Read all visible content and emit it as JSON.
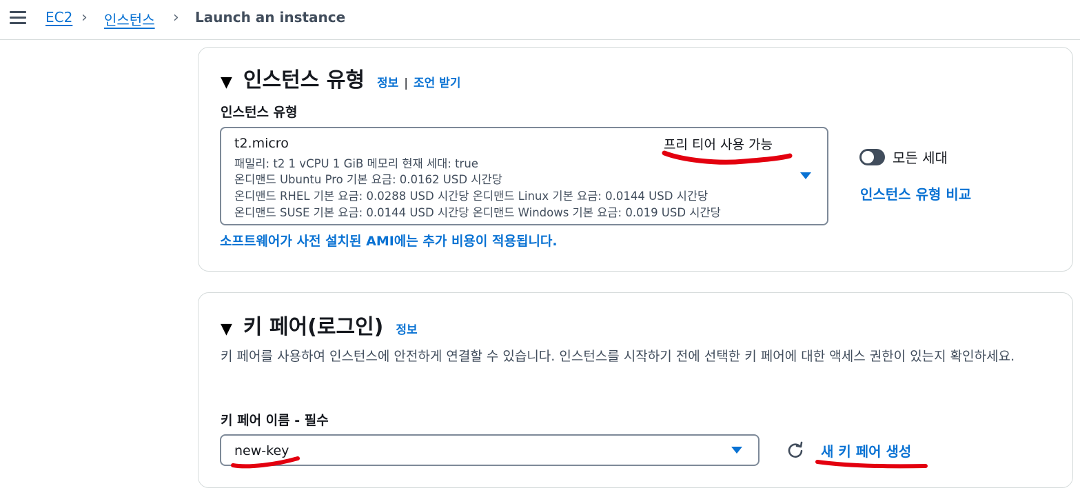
{
  "breadcrumb": {
    "items": [
      "EC2",
      "인스턴스"
    ],
    "current": "Launch an instance"
  },
  "instance_type_section": {
    "title": "인스턴스 유형",
    "info_link": "정보",
    "separator": "|",
    "advice_link": "조언 받기",
    "field_label": "인스턴스 유형",
    "selected": {
      "name": "t2.micro",
      "badge": "프리 티어 사용 가능",
      "line1": "패밀리: t2     1 vCPU     1 GiB 메모리     현재 세대: true",
      "line2": "온디맨드 Ubuntu Pro 기본 요금: 0.0162 USD 시간당",
      "line3": "온디맨드 RHEL 기본 요금: 0.0288 USD 시간당     온디맨드 Linux 기본 요금: 0.0144 USD 시간당",
      "line4": "온디맨드 SUSE 기본 요금: 0.0144 USD 시간당     온디맨드 Windows 기본 요금: 0.019 USD 시간당"
    },
    "toggle_label": "모든 세대",
    "toggle_on": false,
    "compare_link": "인스턴스 유형 비교",
    "ami_note": "소프트웨어가 사전 설치된 AMI에는 추가 비용이 적용됩니다."
  },
  "key_pair_section": {
    "title": "키 페어(로그인)",
    "info_link": "정보",
    "description": "키 페어를 사용하여 인스턴스에 안전하게 연결할 수 있습니다. 인스턴스를 시작하기 전에 선택한 키 페어에 대한 액세스 권한이 있는지 확인하세요.",
    "field_label": "키 페어 이름 - 필수",
    "selected": "new-key",
    "create_link": "새 키 페어 생성"
  },
  "colors": {
    "link": "#0972d3",
    "annotation": "#e3000f",
    "toggle_off": "#414d5c",
    "border": "#7d8998"
  },
  "icons": [
    "menu-icon",
    "chevron-right-icon",
    "caret-down-icon",
    "dropdown-arrow-icon",
    "refresh-icon"
  ]
}
